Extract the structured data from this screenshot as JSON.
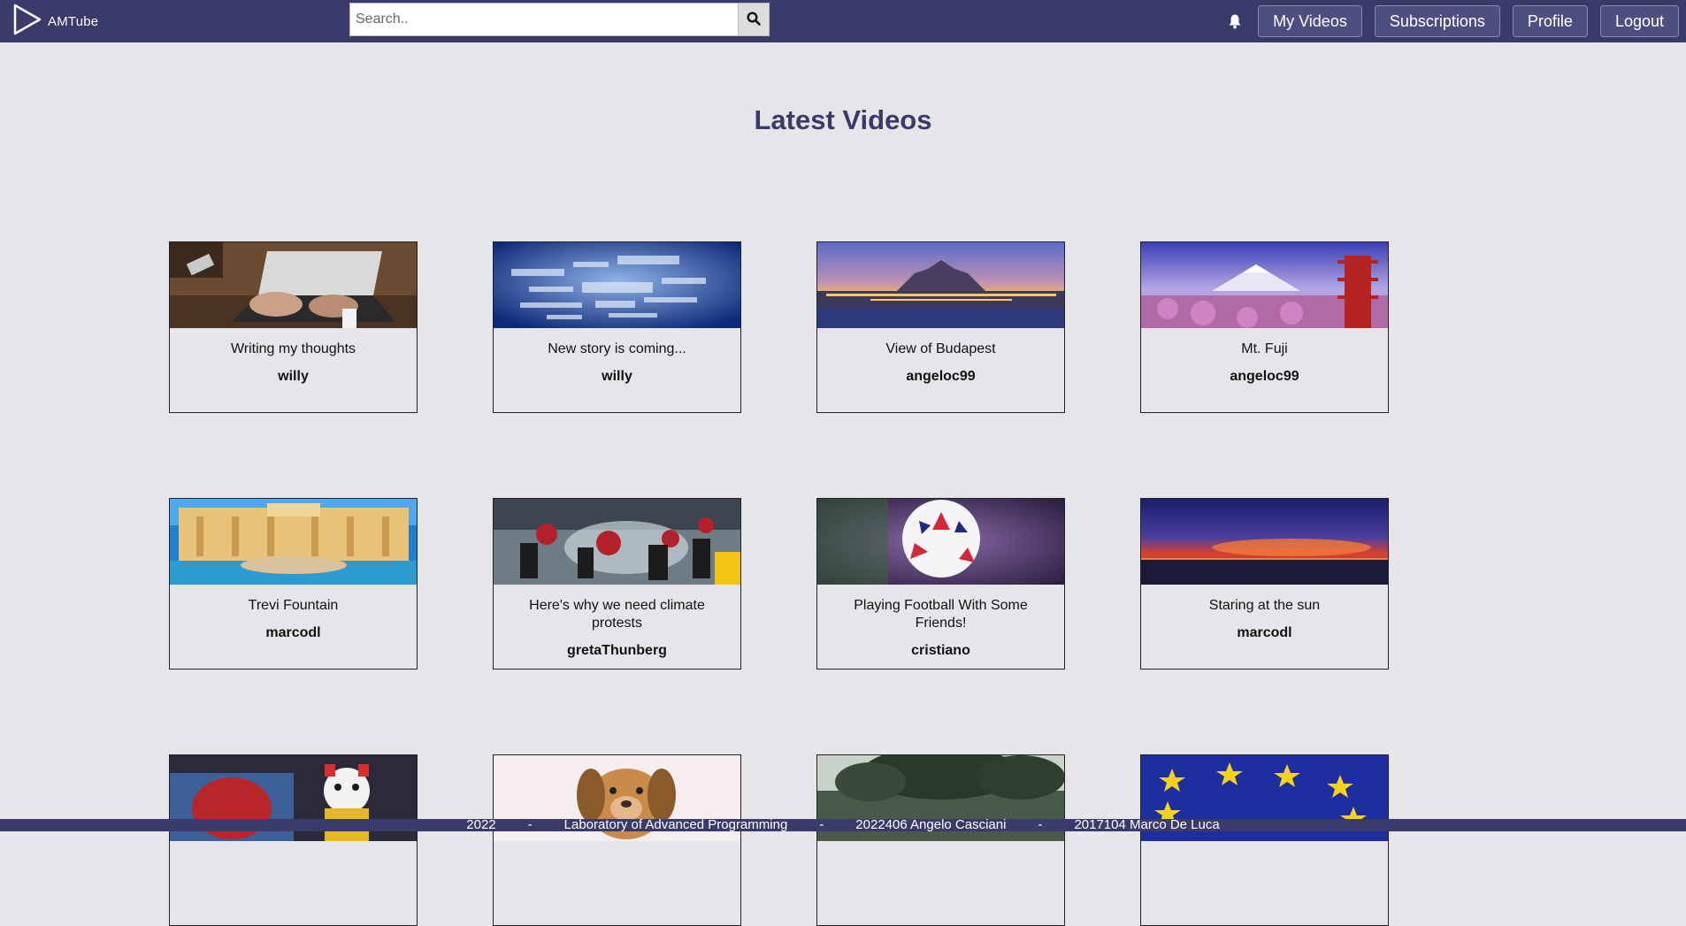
{
  "app": {
    "logo_text": "AMTube"
  },
  "search": {
    "placeholder": "Search.."
  },
  "nav": {
    "my_videos": "My Videos",
    "subscriptions": "Subscriptions",
    "profile": "Profile",
    "logout": "Logout"
  },
  "main": {
    "title": "Latest Videos",
    "videos": [
      {
        "title": "Writing my thoughts",
        "author": "willy"
      },
      {
        "title": "New story is coming...",
        "author": "willy"
      },
      {
        "title": "View of Budapest",
        "author": "angeloc99"
      },
      {
        "title": "Mt. Fuji",
        "author": "angeloc99"
      },
      {
        "title": "Trevi Fountain",
        "author": "marcodl"
      },
      {
        "title": "Here's why we need climate protests",
        "author": "gretaThunberg"
      },
      {
        "title": "Playing Football With Some Friends!",
        "author": "cristiano"
      },
      {
        "title": "Staring at the sun",
        "author": "marcodl"
      }
    ]
  },
  "footer": {
    "year": "2022",
    "sep": "-",
    "course": "Laboratory of Advanced Programming",
    "author1": "2022406 Angelo Casciani",
    "author2": "2017104 Marco De Luca"
  },
  "colors": {
    "navbar": "#3b3b6b",
    "background": "#e6e6ea",
    "title": "#3b3b6b"
  }
}
